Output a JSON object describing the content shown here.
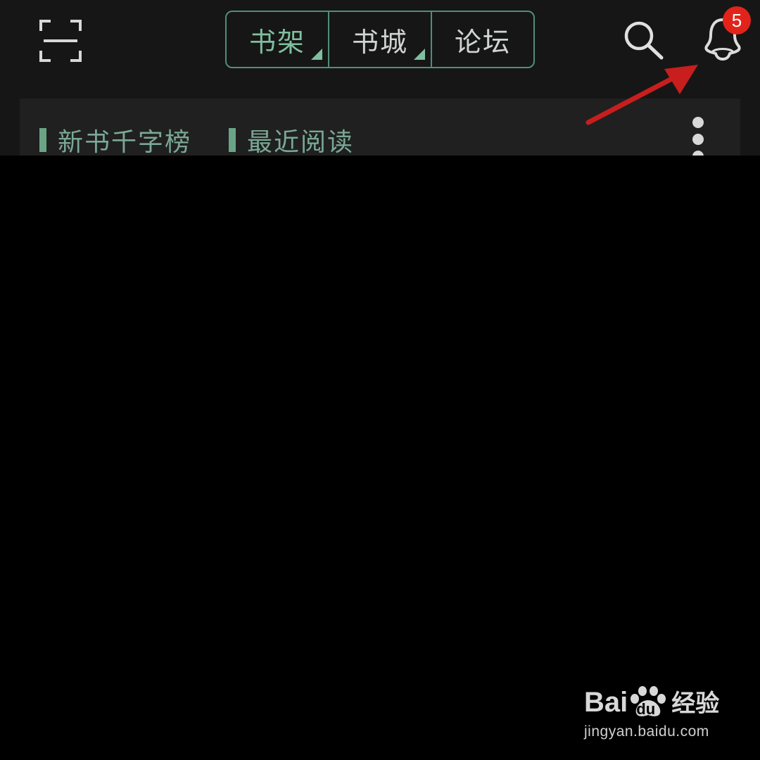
{
  "header": {
    "tabs": [
      {
        "label": "书架",
        "active": true,
        "has_dropdown": true
      },
      {
        "label": "书城",
        "active": false,
        "has_dropdown": true
      },
      {
        "label": "论坛",
        "active": false,
        "has_dropdown": false
      }
    ],
    "left_icon": "scan-icon",
    "right_icons": [
      "search-icon",
      "message-icon"
    ],
    "message_badge": "5"
  },
  "card": {
    "tabs": [
      {
        "label": "新书千字榜"
      },
      {
        "label": "最近阅读"
      }
    ],
    "menu_icon": "more-vertical-icon"
  },
  "annotation": {
    "type": "arrow",
    "color": "#c81e1e"
  },
  "watermark": {
    "logo_text_a": "Bai",
    "logo_text_b": "du",
    "logo_text_c": "经验",
    "url": "jingyan.baidu.com"
  },
  "colors": {
    "background": "#000000",
    "header_bg": "#161616",
    "card_bg": "#202020",
    "accent_green": "#7fbf9f",
    "badge_red": "#e2231a"
  }
}
